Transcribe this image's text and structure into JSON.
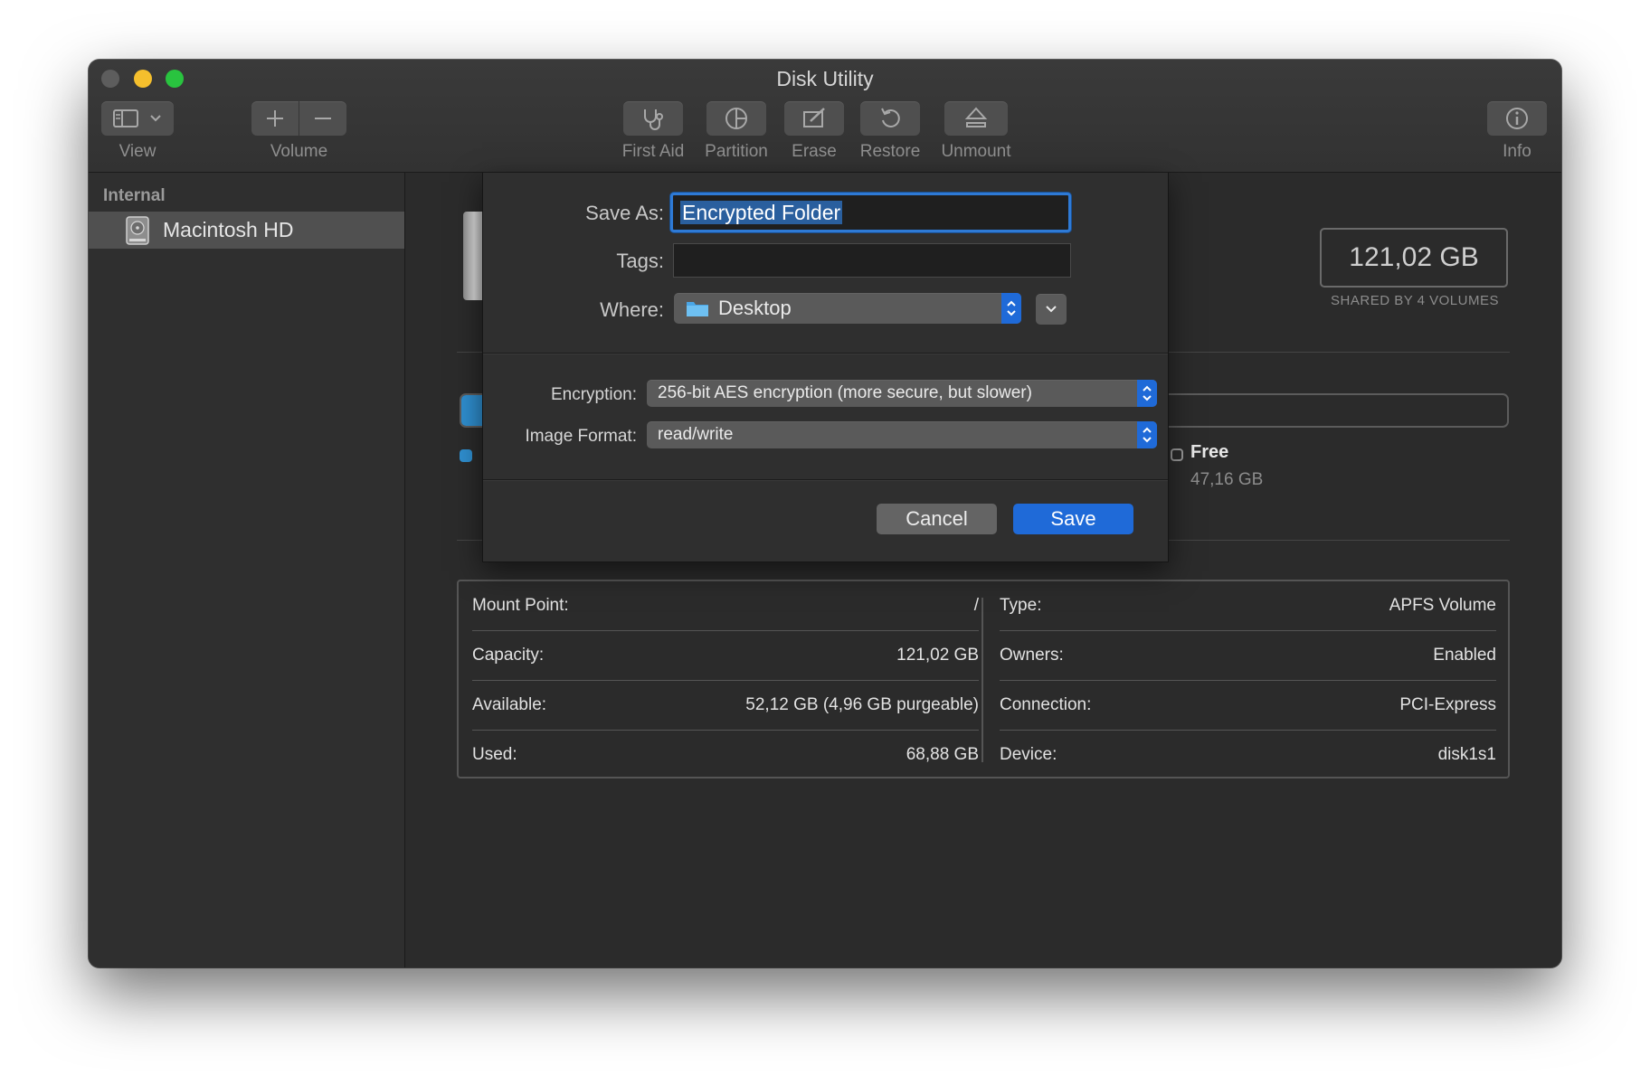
{
  "window": {
    "title": "Disk Utility"
  },
  "toolbar": {
    "view_label": "View",
    "volume_label": "Volume",
    "first_aid_label": "First Aid",
    "partition_label": "Partition",
    "erase_label": "Erase",
    "restore_label": "Restore",
    "unmount_label": "Unmount",
    "info_label": "Info"
  },
  "sidebar": {
    "header": "Internal",
    "items": [
      {
        "label": "Macintosh HD",
        "icon": "internal-disk-icon",
        "selected": true
      }
    ]
  },
  "volume": {
    "capacity": "121,02 GB",
    "capacity_sub": "SHARED BY 4 VOLUMES",
    "used_fraction": 0.61,
    "free_label": "Free",
    "free_value": "47,16 GB",
    "accent_color": "#2f8fd0"
  },
  "info": {
    "left": [
      {
        "key": "Mount Point:",
        "value": "/"
      },
      {
        "key": "Capacity:",
        "value": "121,02 GB"
      },
      {
        "key": "Available:",
        "value": "52,12 GB (4,96 GB purgeable)"
      },
      {
        "key": "Used:",
        "value": "68,88 GB"
      }
    ],
    "right": [
      {
        "key": "Type:",
        "value": "APFS Volume"
      },
      {
        "key": "Owners:",
        "value": "Enabled"
      },
      {
        "key": "Connection:",
        "value": "PCI-Express"
      },
      {
        "key": "Device:",
        "value": "disk1s1"
      }
    ]
  },
  "dialog": {
    "save_as_label": "Save As:",
    "save_as_value": "Encrypted Folder",
    "tags_label": "Tags:",
    "tags_value": "",
    "where_label": "Where:",
    "where_value": "Desktop",
    "encryption_label": "Encryption:",
    "encryption_value": "256-bit AES encryption (more secure, but slower)",
    "format_label": "Image Format:",
    "format_value": "read/write",
    "cancel_label": "Cancel",
    "save_label": "Save",
    "primary_color": "#1f6ad8"
  }
}
